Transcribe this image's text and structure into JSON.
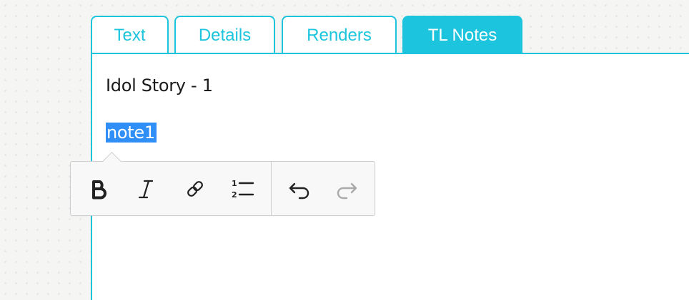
{
  "tabs": [
    {
      "label": "Text",
      "active": false
    },
    {
      "label": "Details",
      "active": false
    },
    {
      "label": "Renders",
      "active": false
    },
    {
      "label": "TL Notes",
      "active": true
    }
  ],
  "editor": {
    "line1": "Idol Story - 1",
    "selected_text": "note1"
  },
  "toolbar": {
    "buttons": [
      {
        "name": "bold",
        "icon": "bold-icon",
        "enabled": true
      },
      {
        "name": "italic",
        "icon": "italic-icon",
        "enabled": true
      },
      {
        "name": "link",
        "icon": "link-icon",
        "enabled": true
      },
      {
        "name": "numbered-list",
        "icon": "numbered-list-icon",
        "enabled": true
      },
      {
        "name": "undo",
        "icon": "undo-icon",
        "enabled": true
      },
      {
        "name": "redo",
        "icon": "redo-icon",
        "enabled": false
      }
    ]
  },
  "colors": {
    "accent": "#1cc5dd",
    "selection": "#2f8ff7",
    "disabled_icon": "#aaaaaa"
  }
}
